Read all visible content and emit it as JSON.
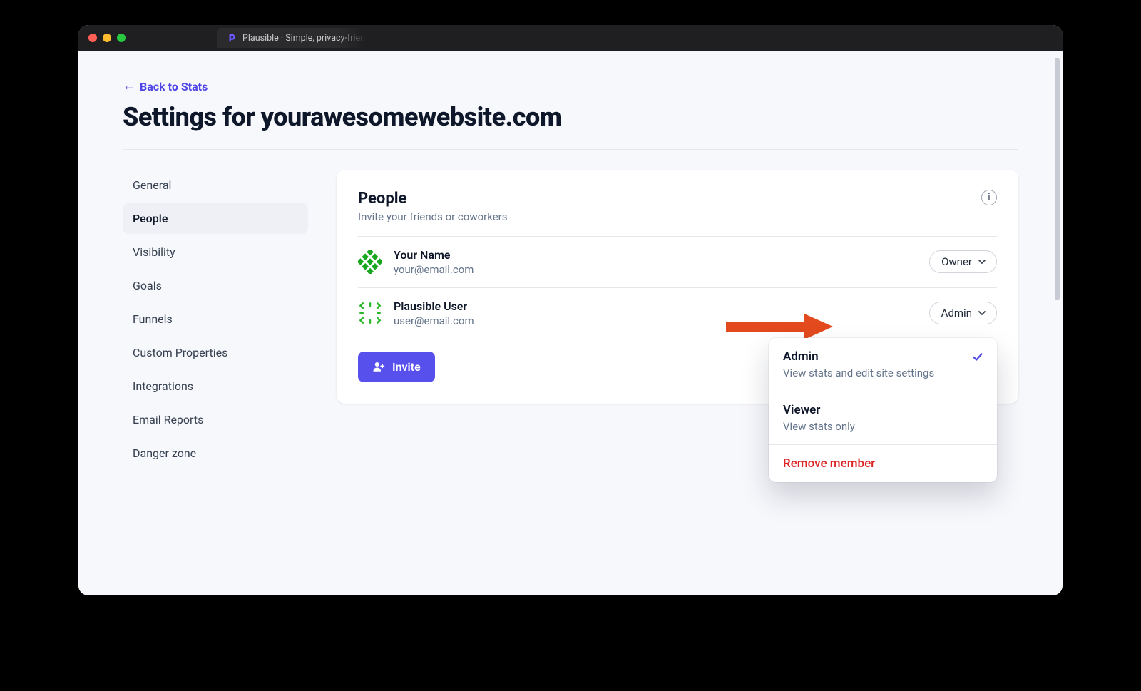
{
  "browser": {
    "tab_title": "Plausible · Simple, privacy-friendly analytics"
  },
  "header": {
    "back_link": "Back to Stats",
    "title": "Settings for yourawesomewebsite.com"
  },
  "sidenav": {
    "items": [
      "General",
      "People",
      "Visibility",
      "Goals",
      "Funnels",
      "Custom Properties",
      "Integrations",
      "Email Reports",
      "Danger zone"
    ],
    "active_index": 1
  },
  "panel": {
    "title": "People",
    "subtitle": "Invite your friends or coworkers",
    "invite_label": "Invite"
  },
  "members": [
    {
      "name": "Your Name",
      "email": "your@email.com",
      "role": "Owner"
    },
    {
      "name": "Plausible User",
      "email": "user@email.com",
      "role": "Admin"
    }
  ],
  "role_menu": {
    "items": [
      {
        "title": "Admin",
        "desc": "View stats and edit site settings",
        "selected": true
      },
      {
        "title": "Viewer",
        "desc": "View stats only",
        "selected": false
      }
    ],
    "remove_label": "Remove member"
  },
  "colors": {
    "accent": "#5850ec",
    "danger": "#dc2626",
    "annotation_arrow": "#e34a1e"
  }
}
